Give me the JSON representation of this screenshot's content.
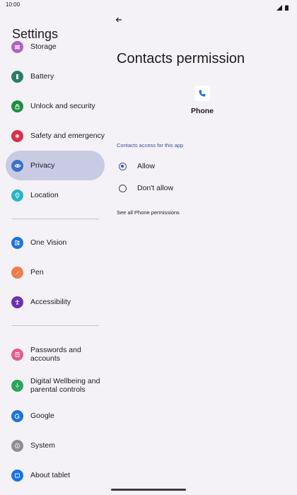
{
  "status_bar": {
    "time": "10:00"
  },
  "settings": {
    "title": "Settings",
    "items": [
      {
        "label": "Storage",
        "icon": "storage-icon",
        "color": "#b55fc6"
      },
      {
        "label": "Battery",
        "icon": "battery-icon",
        "color": "#2e7d6c"
      },
      {
        "label": "Unlock and security",
        "icon": "lock-icon",
        "color": "#1e8e3e"
      },
      {
        "label": "Safety and emergency",
        "icon": "asterisk-icon",
        "color": "#d93049"
      },
      {
        "label": "Privacy",
        "icon": "privacy-eye-icon",
        "color": "#3d71c9",
        "selected": true
      },
      {
        "label": "Location",
        "icon": "location-pin-icon",
        "color": "#26b5c7"
      },
      {
        "label": "One Vision",
        "icon": "one-vision-icon",
        "color": "#1a73e8"
      },
      {
        "label": "Pen",
        "icon": "pen-icon",
        "color": "#f07c48"
      },
      {
        "label": "Accessibility",
        "icon": "accessibility-icon",
        "color": "#6b2fb5"
      },
      {
        "label": "Passwords and accounts",
        "icon": "passwords-icon",
        "color": "#e8598a"
      },
      {
        "label": "Digital Wellbeing and parental controls",
        "icon": "wellbeing-icon",
        "color": "#2aa55a"
      },
      {
        "label": "Google",
        "icon": "google-icon",
        "color": "#1a73e8"
      },
      {
        "label": "System",
        "icon": "info-icon",
        "color": "#8e8e93"
      },
      {
        "label": "About tablet",
        "icon": "tablet-icon",
        "color": "#1a73e8"
      }
    ]
  },
  "detail": {
    "title": "Contacts permission",
    "app_name": "Phone",
    "section_label": "Contacts access for this app",
    "options": [
      {
        "label": "Allow",
        "checked": true
      },
      {
        "label": "Don't allow",
        "checked": false
      }
    ],
    "see_all_link": "See all Phone permissions"
  },
  "colors": {
    "accent": "#3f51b5",
    "selected_background": "#c9cbe4",
    "background": "#f4f2f6"
  }
}
